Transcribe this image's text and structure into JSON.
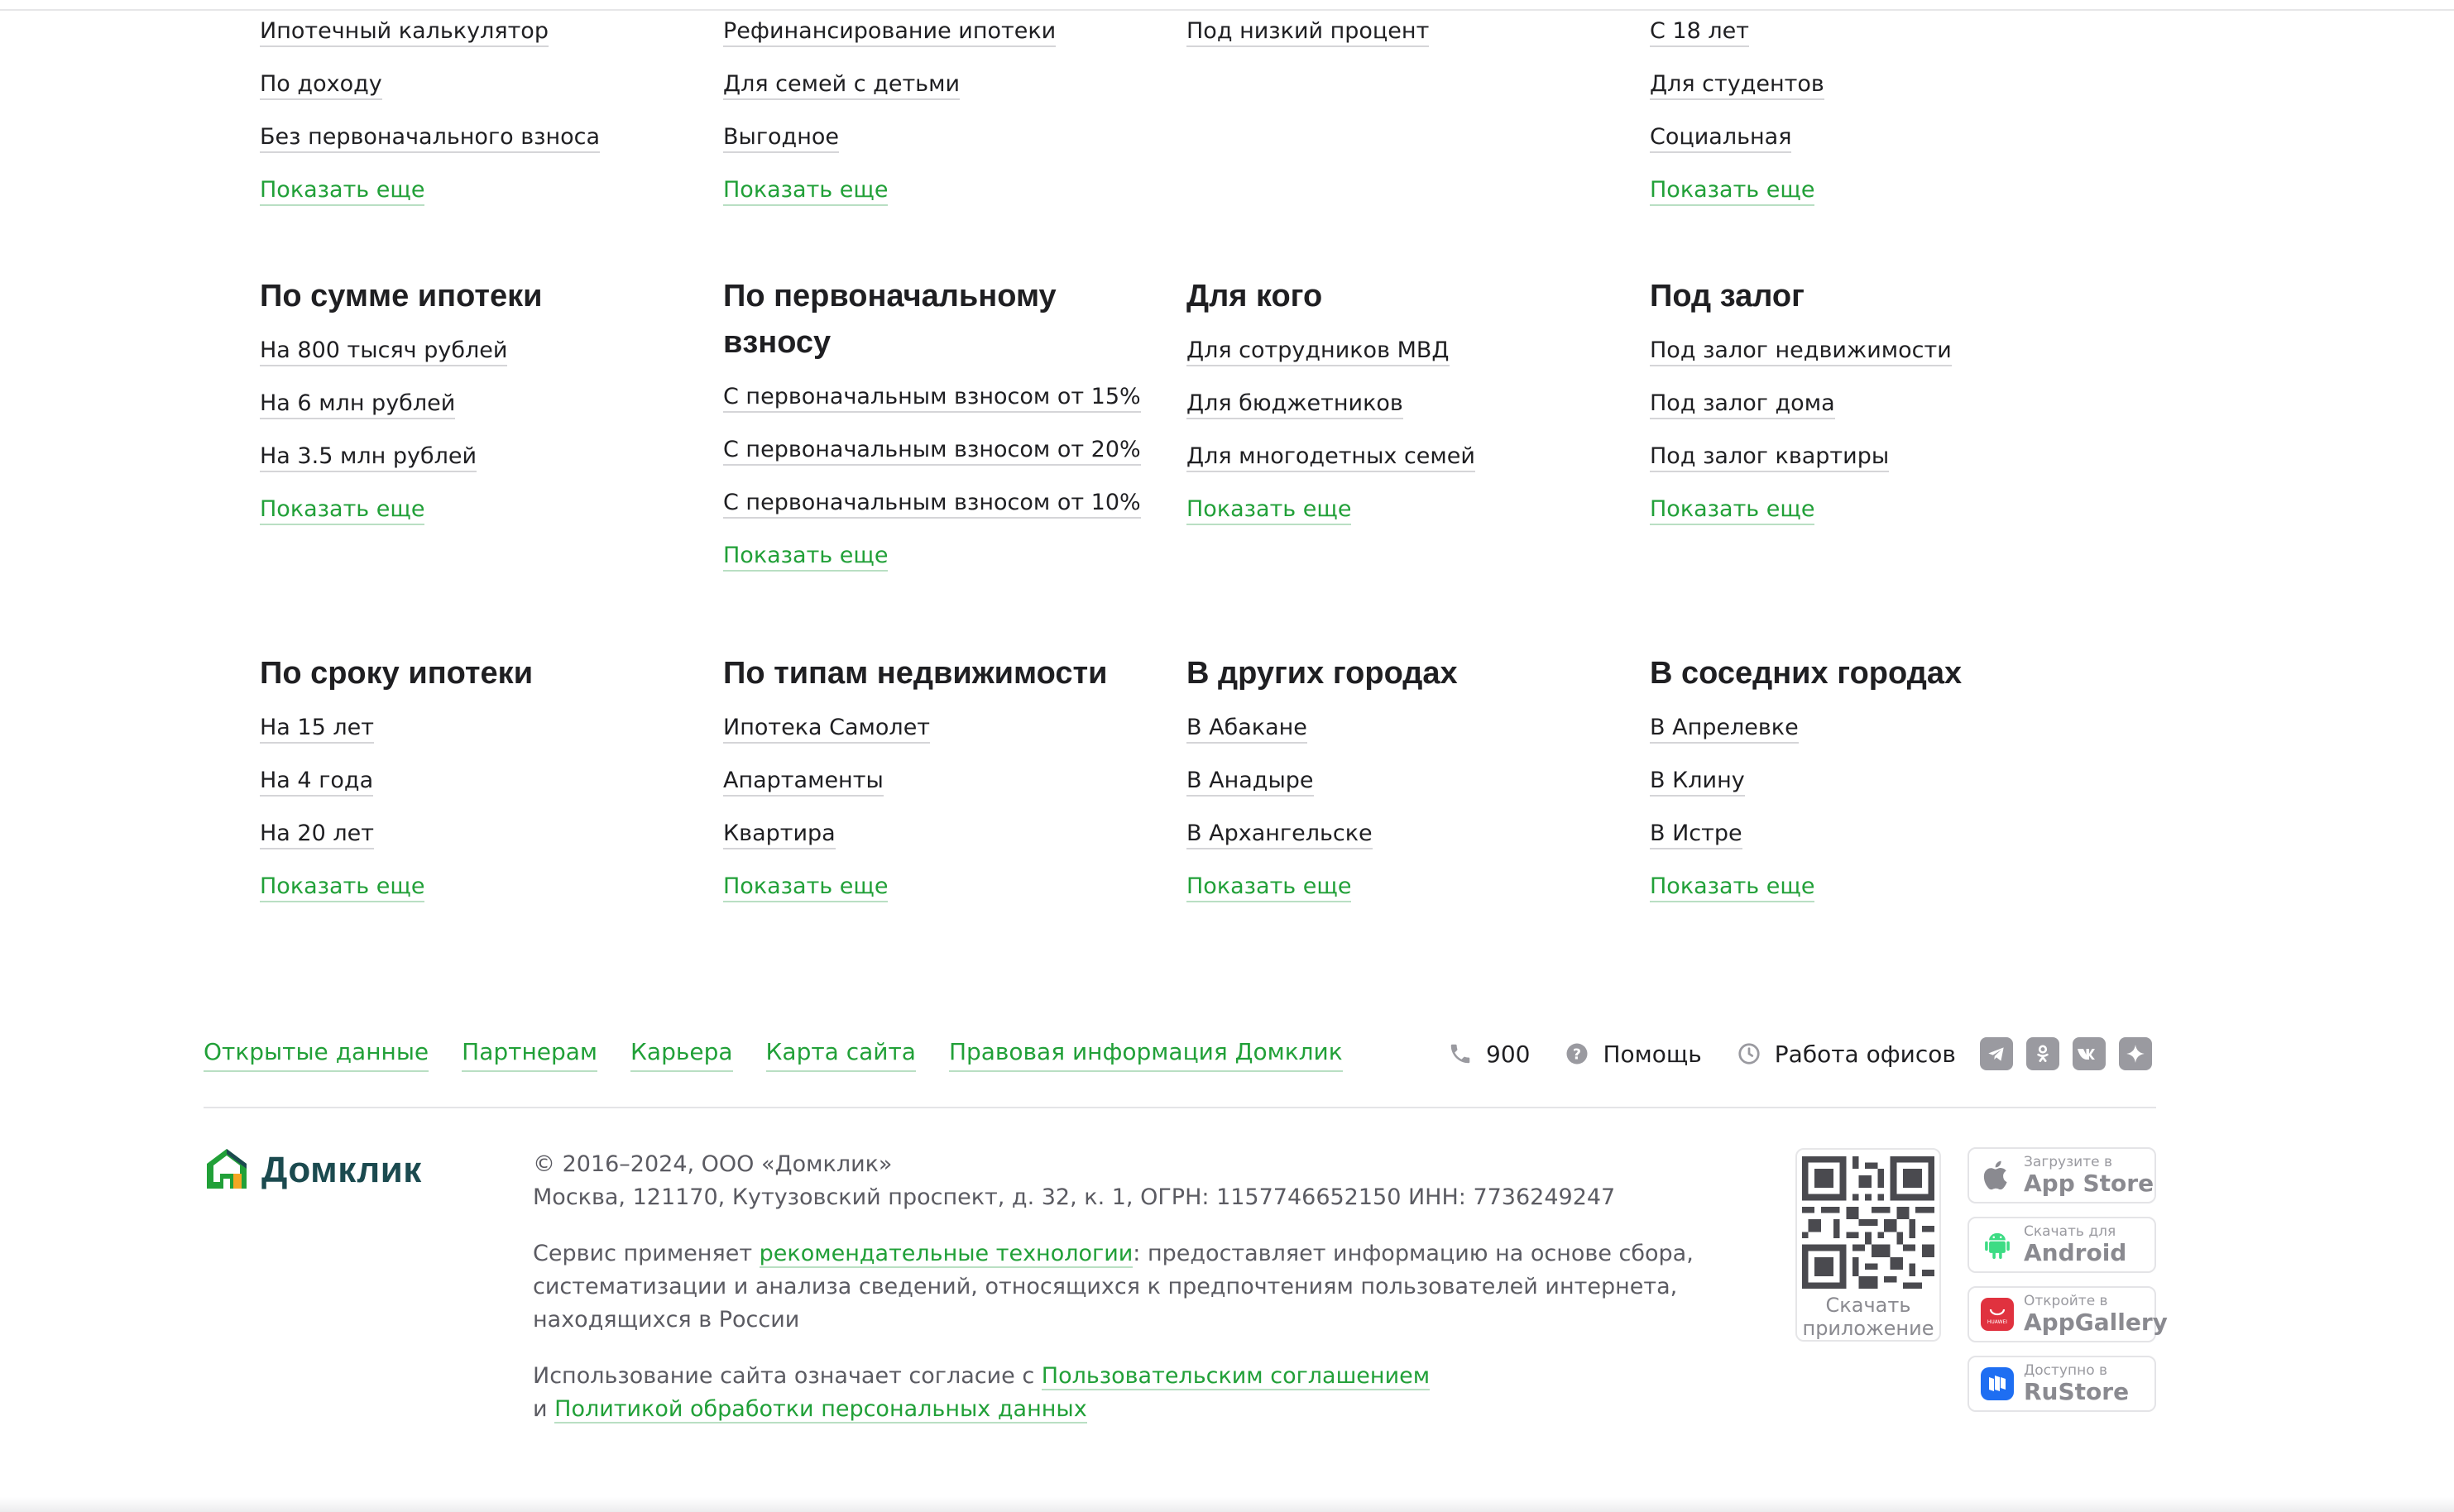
{
  "sections": [
    {
      "title": "",
      "items": [
        "Ипотечный калькулятор",
        "По доходу",
        "Без первоначального взноса"
      ],
      "more": "Показать еще"
    },
    {
      "title": "",
      "items": [
        "Рефинансирование ипотеки",
        "Для семей с детьми",
        "Выгодное"
      ],
      "more": "Показать еще"
    },
    {
      "title": "",
      "items": [
        "Под низкий процент"
      ],
      "more": ""
    },
    {
      "title": "",
      "items": [
        "С 18 лет",
        "Для студентов",
        "Социальная"
      ],
      "more": "Показать еще"
    },
    {
      "title": "По сумме ипотеки",
      "items": [
        "На 800 тысяч рублей",
        "На 6 млн рублей",
        "На 3.5 млн рублей"
      ],
      "more": "Показать еще"
    },
    {
      "title": "По первоначальному взносу",
      "items": [
        "С первоначальным взносом от 15%",
        "С первоначальным взносом от 20%",
        "С первоначальным взносом от 10%"
      ],
      "more": "Показать еще"
    },
    {
      "title": "Для кого",
      "items": [
        "Для сотрудников МВД",
        "Для бюджетников",
        "Для многодетных семей"
      ],
      "more": "Показать еще"
    },
    {
      "title": "Под залог",
      "items": [
        "Под залог недвижимости",
        "Под залог дома",
        "Под залог квартиры"
      ],
      "more": "Показать еще"
    },
    {
      "title": "По сроку ипотеки",
      "items": [
        "На 15 лет",
        "На 4 года",
        "На 20 лет"
      ],
      "more": "Показать еще"
    },
    {
      "title": "По типам недвижимости",
      "items": [
        "Ипотека Самолет",
        "Апартаменты",
        "Квартира"
      ],
      "more": "Показать еще"
    },
    {
      "title": "В других городах",
      "items": [
        "В Абакане",
        "В Анадыре",
        "В Архангельске"
      ],
      "more": "Показать еще"
    },
    {
      "title": "В соседних городах",
      "items": [
        "В Апрелевке",
        "В Клину",
        "В Истре"
      ],
      "more": "Показать еще"
    }
  ],
  "footer": {
    "links": [
      "Открытые данные",
      "Партнерам",
      "Карьера",
      "Карта сайта",
      "Правовая информация Домклик"
    ],
    "phone": "900",
    "help": "Помощь",
    "offices": "Работа офисов",
    "socials": [
      "telegram-icon",
      "ok-icon",
      "vk-icon",
      "sparkle-icon"
    ],
    "brand": "Домклик",
    "copyright": "© 2016–2024, ООО «Домклик»",
    "address": "Москва, 121170, Кутузовский проспект, д. 32, к. 1, ОГРН: 1157746652150 ИНН: 7736249247",
    "service_pre": "Сервис применяет ",
    "service_link": "рекомендательные технологии",
    "service_post": ": предоставляет информацию на основе сбора, систематизации и анализа сведений, относящихся к предпочтениям пользователей интернета, находящихся в России",
    "usage_pre": "Использование сайта означает согласие с ",
    "usage_link1": "Пользовательским соглашением",
    "usage_mid": "и ",
    "usage_link2": "Политикой обработки персональных данных",
    "qr_caption": "Скачать приложение",
    "stores": [
      {
        "small": "Загрузите в",
        "big": "App Store",
        "icon": "apple-icon"
      },
      {
        "small": "Скачать для",
        "big": "Android",
        "icon": "android-icon"
      },
      {
        "small": "Откройте в",
        "big": "AppGallery",
        "icon": "huawei-icon"
      },
      {
        "small": "Доступно в",
        "big": "RuStore",
        "icon": "rustore-icon"
      }
    ],
    "colors": {
      "accent": "#21a038",
      "brand_dark": "#1b4a4f",
      "muted": "#5b5b62"
    }
  }
}
